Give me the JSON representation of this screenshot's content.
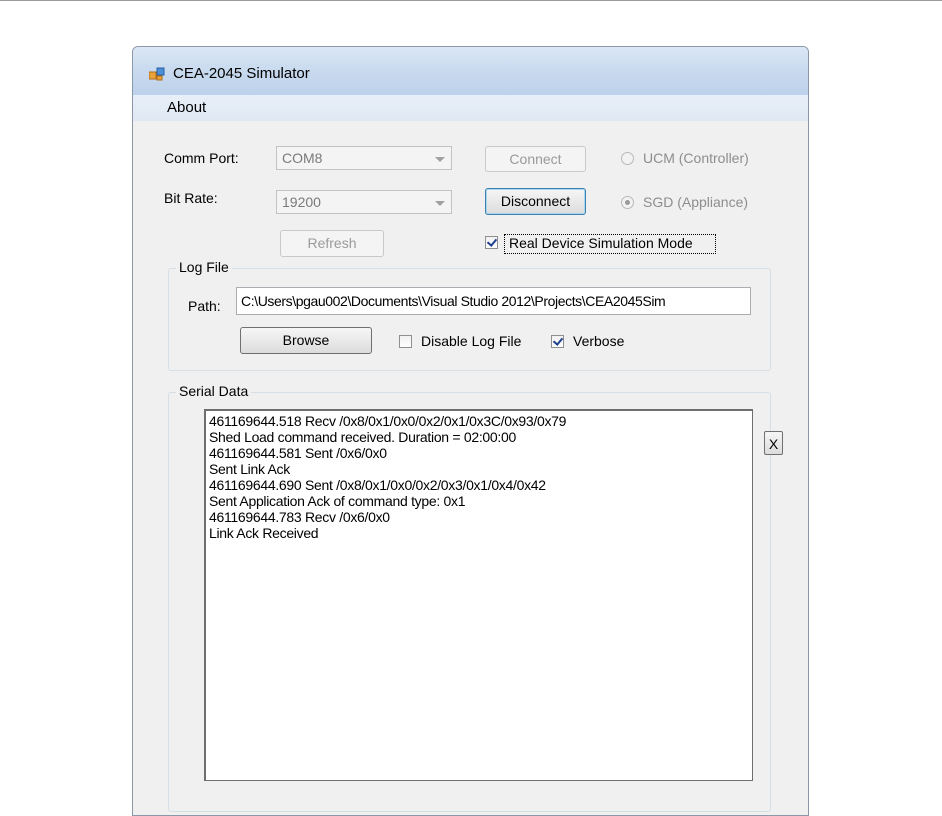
{
  "window": {
    "title": "CEA-2045 Simulator"
  },
  "menu": {
    "about": "About"
  },
  "connection": {
    "comm_port_label": "Comm Port:",
    "comm_port_value": "COM8",
    "bit_rate_label": "Bit Rate:",
    "bit_rate_value": "19200",
    "connect_label": "Connect",
    "disconnect_label": "Disconnect",
    "refresh_label": "Refresh",
    "ucm_label": "UCM (Controller)",
    "sgd_label": "SGD (Appliance)",
    "sgd_selected": true,
    "real_device_label": "Real Device Simulation Mode",
    "real_device_checked": true
  },
  "log_file": {
    "group_title": "Log File",
    "path_label": "Path:",
    "path_value": "C:\\Users\\pgau002\\Documents\\Visual Studio 2012\\Projects\\CEA2045Sim",
    "browse_label": "Browse",
    "disable_label": "Disable Log File",
    "disable_checked": false,
    "verbose_label": "Verbose",
    "verbose_checked": true
  },
  "serial_data": {
    "group_title": "Serial Data",
    "clear_label": "X",
    "lines": [
      "461169644.518 Recv  /0x8/0x1/0x0/0x2/0x1/0x3C/0x93/0x79",
      "Shed Load command received. Duration = 02:00:00",
      "461169644.581 Sent  /0x6/0x0",
      "Sent Link Ack",
      "461169644.690 Sent  /0x8/0x1/0x0/0x2/0x3/0x1/0x4/0x42",
      "Sent Application Ack of command type: 0x1",
      "461169644.783 Recv  /0x6/0x0",
      "Link Ack Received"
    ]
  },
  "icons": {
    "app": "app-window-icon"
  },
  "colors": {
    "titlebar": "#cadbef",
    "window_bg": "#f0f0f0",
    "checkmark": "#1f3f8f"
  }
}
